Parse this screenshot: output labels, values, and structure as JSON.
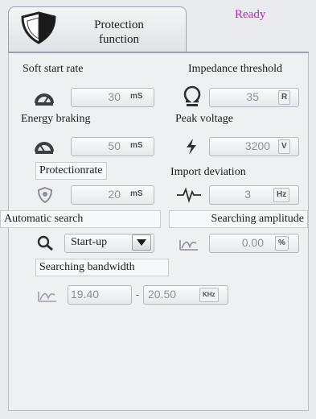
{
  "header": {
    "tab_label_1": "Protection",
    "tab_label_2": "function",
    "status": "Ready",
    "status_color": "#c41ec4",
    "tab_icon": "shield-icon"
  },
  "fields": {
    "soft_start_rate": {
      "label": "Soft start rate",
      "value": "30",
      "unit": "mS",
      "icon": "speedometer-start-icon"
    },
    "impedance_threshold": {
      "label": "Impedance threshold",
      "value": "35",
      "unit": "R",
      "icon": "ohm-icon"
    },
    "energy_braking": {
      "label": "Energy braking",
      "value": "50",
      "unit": "mS",
      "icon": "speedometer-stop-icon"
    },
    "peak_voltage": {
      "label": "Peak voltage",
      "value": "3200",
      "unit": "V",
      "icon": "lightning-icon"
    },
    "protection_rate": {
      "label": "Protectionrate",
      "value": "20",
      "unit": "mS",
      "icon": "shield-outline-icon"
    },
    "import_deviation": {
      "label": "Import deviation",
      "value": "3",
      "unit": "Hz",
      "icon": "waveform-icon"
    },
    "automatic_search": {
      "label": "Automatic search",
      "value": "Start-up",
      "icon": "search-icon"
    },
    "searching_amplitude": {
      "label": "Searching amplitude",
      "value": "0.00",
      "unit": "%",
      "icon": "amplitude-icon"
    },
    "searching_bandwidth": {
      "label": "Searching bandwidth",
      "value_from": "19.40",
      "separator": "-",
      "value_to": "20.50",
      "unit": "KHz",
      "icon": "bandwidth-icon"
    }
  }
}
